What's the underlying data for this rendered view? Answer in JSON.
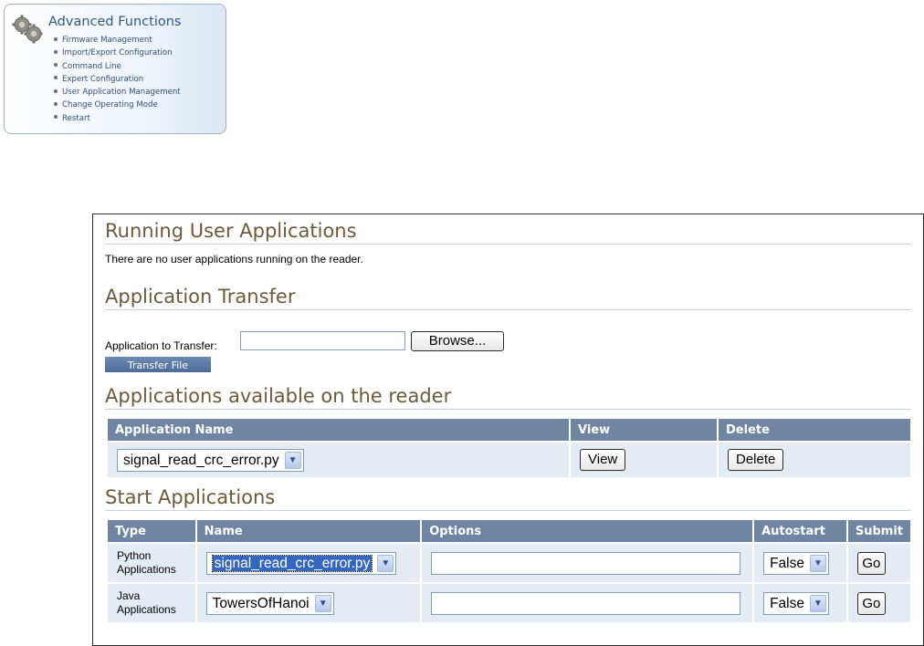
{
  "advanced": {
    "title": "Advanced Functions",
    "items": [
      "Firmware Management",
      "Import/Export Configuration",
      "Command Line",
      "Expert Configuration",
      "User Application Management",
      "Change Operating Mode",
      "Restart"
    ]
  },
  "running": {
    "heading": "Running User Applications",
    "message": "There are no user applications running on the reader."
  },
  "transfer": {
    "heading": "Application Transfer",
    "label": "Application to Transfer:",
    "file_value": "",
    "browse_label": "Browse...",
    "transfer_button": "Transfer File"
  },
  "available": {
    "heading": "Applications available on the reader",
    "headers": [
      "Application Name",
      "View",
      "Delete"
    ],
    "selected_app": "signal_read_crc_error.py",
    "view_label": "View",
    "delete_label": "Delete"
  },
  "start": {
    "heading": "Start Applications",
    "headers": [
      "Type",
      "Name",
      "Options",
      "Autostart",
      "Submit"
    ],
    "rows": [
      {
        "type_line1": "Python",
        "type_line2": "Applications",
        "name": "signal_read_crc_error.py",
        "options": "",
        "autostart": "False",
        "submit": "Go"
      },
      {
        "type_line1": "Java",
        "type_line2": "Applications",
        "name": "TowersOfHanoi",
        "options": "",
        "autostart": "False",
        "submit": "Go"
      }
    ]
  },
  "colors": {
    "header_bg": "#6f85a2",
    "cell_bg": "#e4ebf3",
    "heading_text": "#6e5a3a",
    "link_text": "#2f4f78"
  }
}
